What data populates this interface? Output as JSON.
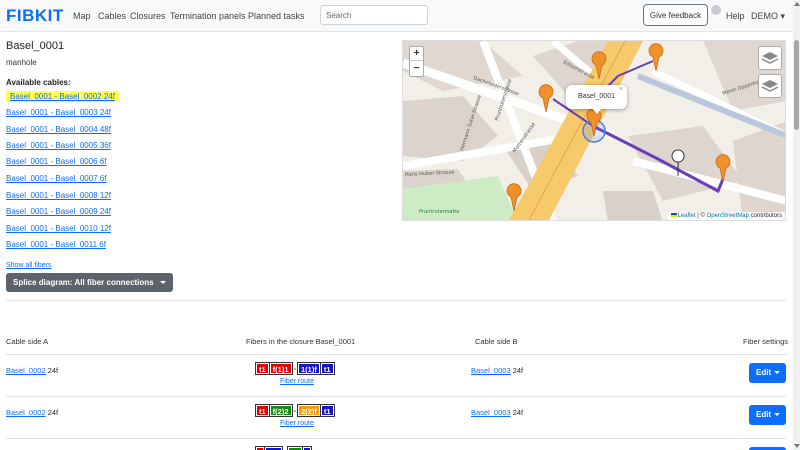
{
  "navbar": {
    "brand": "FIBKIT",
    "links": [
      "Map",
      "Cables",
      "Closures",
      "Termination panels",
      "Planned tasks"
    ],
    "search_placeholder": "Search",
    "feedback_label": "Give feedback",
    "help_label": "Help",
    "user_menu_label": "DEMO ▾"
  },
  "closure": {
    "name": "Basel_0001",
    "type": "manhole",
    "available_cables_label": "Available cables:",
    "cables": [
      "Basel_0001 - Basel_0002 24f",
      "Basel_0001 - Basel_0003 24f",
      "Basel_0001 - Basel_0004 48f",
      "Basel_0001 - Basel_0005 36f",
      "Basel_0001 - Basel_0006 6f",
      "Basel_0001 - Basel_0007 6f",
      "Basel_0001 - Basel_0008 12f",
      "Basel_0001 - Basel_0009 24f",
      "Basel_0001 - Basel_0010 12f",
      "Basel_0001 - Basel_0011 6f"
    ],
    "highlighted_cable_index": 0,
    "show_all_label": "Show all fibers",
    "splice_diagram_label": "Splice diagram: All fiber connections"
  },
  "map": {
    "zoom_in": "+",
    "zoom_out": "−",
    "popup_label": "Basel_0001",
    "popup_close": "×",
    "attribution_leaflet": "Leaflet",
    "attribution_sep": " | © ",
    "attribution_osm": "OpenStreetMap",
    "attribution_tail": " contributors",
    "streets": [
      "Dachsfelderstrasse",
      "Edisonstrasse",
      "Meret Oppenheim",
      "Mattenstrasse",
      "Hermann Suter-Strasse",
      "Pruntruterstrasse",
      "Hans Huber-Strasse",
      "Pruntrutermatte"
    ]
  },
  "table": {
    "headers": {
      "side_a": "Cable side A",
      "fibers": "Fibers in the closure Basel_0001",
      "side_b": "Cable side B",
      "settings": "Fiber settings"
    },
    "rows": [
      {
        "side_a_link": "Basel_0002",
        "side_a_count": " 24f",
        "chips": [
          {
            "text": "t1",
            "color": "red"
          },
          {
            "text": "f(1)1",
            "color": "red"
          },
          {
            "text": "-",
            "color": "plain"
          },
          {
            "text": "1(1)f",
            "color": "blue"
          },
          {
            "text": "t1",
            "color": "blue"
          }
        ],
        "route_label": "Fiber route",
        "side_b_link": "Basel_0003",
        "side_b_count": " 24f",
        "edit_label": "Edit"
      },
      {
        "side_a_link": "Basel_0002",
        "side_a_count": " 24f",
        "chips": [
          {
            "text": "t1",
            "color": "red"
          },
          {
            "text": "f(2)2",
            "color": "green"
          },
          {
            "text": "-",
            "color": "plain"
          },
          {
            "text": "2(2)f",
            "color": "orange"
          },
          {
            "text": "t1",
            "color": "blue"
          }
        ],
        "route_label": "Fiber route",
        "side_b_link": "Basel_0003",
        "side_b_count": " 24f",
        "edit_label": "Edit"
      }
    ]
  },
  "colors": {
    "primary": "#0d6efd",
    "highlight": "#ffff4d",
    "splice_button": "#5c636a",
    "marker": "#f0902a",
    "route": "#6a3db8"
  }
}
